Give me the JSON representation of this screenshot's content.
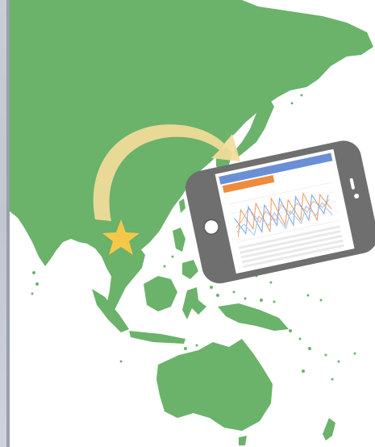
{
  "colors": {
    "land": "#6bb26b",
    "sea": "#ffffff",
    "arrow": "#f3dc9a",
    "star": "#f6c84a",
    "phone_body": "#6f6f6f",
    "phone_screen": "#ffffff",
    "header_blue": "#6a8fd6",
    "header_orange": "#f08a3c",
    "line_orange": "#f09a5a",
    "line_blue": "#7aa4e6"
  },
  "icons": {
    "star": "star-icon",
    "arrow": "curved-arrow-icon"
  },
  "phone": {
    "screen_header_left": "",
    "screen_header_right": "",
    "screen_subtitle": ""
  }
}
